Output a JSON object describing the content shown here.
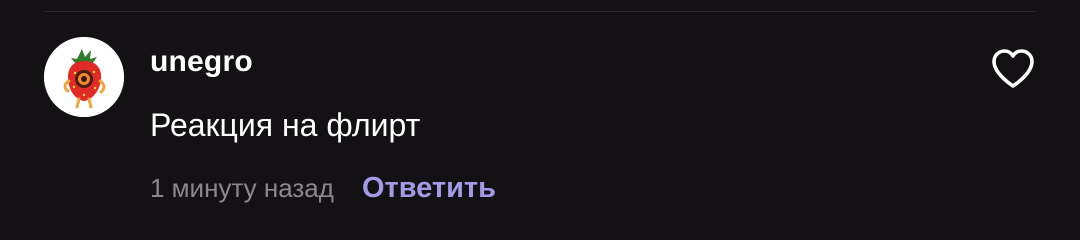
{
  "comment": {
    "username": "unegro",
    "text": "Реакция на флирт",
    "timestamp": "1 минуту назад",
    "reply_label": "Ответить"
  },
  "icons": {
    "avatar": "strawberry-character-avatar",
    "like": "heart-outline-icon"
  },
  "colors": {
    "background": "#141115",
    "text_primary": "#ffffff",
    "text_secondary": "#8b878d",
    "accent": "#a39be6"
  }
}
